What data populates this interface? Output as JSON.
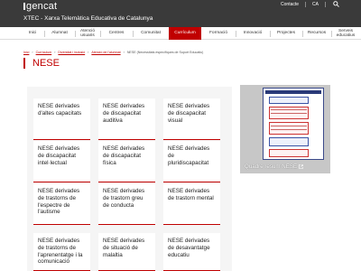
{
  "header": {
    "logo": "gencat",
    "subtitle": "XTEC - Xarxa Telemàtica Educativa de Catalunya",
    "contact": "Contacte",
    "language": "CA",
    "search_icon": "search-icon"
  },
  "nav": {
    "items": [
      {
        "label": "Inici"
      },
      {
        "label": "Alumnat"
      },
      {
        "label": "Atenció usuaris"
      },
      {
        "label": "Centres"
      },
      {
        "label": "Comunitat"
      },
      {
        "label": "Currículum",
        "active": true
      },
      {
        "label": "Formació"
      },
      {
        "label": "Innovació"
      },
      {
        "label": "Projectes"
      },
      {
        "label": "Recursos"
      },
      {
        "label": "Serveis educatius"
      }
    ],
    "active_color": "#c00000"
  },
  "breadcrumb": {
    "items": [
      "Inici",
      "Currículum",
      "Diversitat i inclusió",
      "Atenció de l'alumnat"
    ],
    "current": "NESE (Necessitats específiques de Suport Educatiu)"
  },
  "page": {
    "title": "NESE"
  },
  "cards": [
    "NESE derivades d'altes capacitats",
    "NESE derivades de discapacitat auditiva",
    "NESE derivades de discapacitat visual",
    "NESE derivades de discapacitat intel·lectual",
    "NESE derivades de discapacitat física",
    "NESE derivades de pluridiscapacitat",
    "NESE derivades de trastorns de l'espectre de l'autisme",
    "NESE derivades de trastorn greu de conducta",
    "NESE derivades de trastorn mental",
    "NESE derivades de trastorns de l'aprenentatge i la comunicació",
    "NESE derivades de situació de malaltia",
    "NESE derivades de desavantatge educatiu"
  ],
  "sidebar": {
    "resum_label": "Quadre resum NESE",
    "external_icon": "external-link-icon"
  },
  "colors": {
    "accent": "#c00000",
    "header_bg": "#3a3a3a",
    "card_area_bg": "#f5f5f5"
  }
}
